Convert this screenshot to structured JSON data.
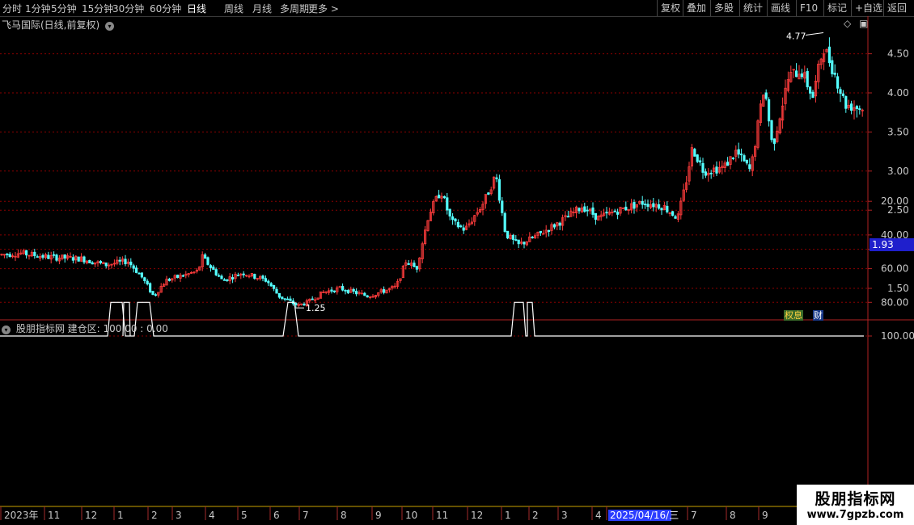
{
  "toolbar": {
    "left_items": [
      "分时",
      "1分钟",
      "5分钟",
      "15分钟",
      "30分钟",
      "60分钟",
      "日线",
      "周线",
      "月线",
      "多周期",
      "更多 >"
    ],
    "active": "日线",
    "right_items": [
      "复权",
      "叠加",
      "多股",
      "统计",
      "画线",
      "F10",
      "标记",
      "+自选",
      "返回"
    ]
  },
  "main_panel": {
    "title": "飞马国际(日线,前复权)",
    "max_label": "4.77",
    "min_label": "1.25",
    "current_price": "1.93",
    "y_ticks": [
      "4.50",
      "4.00",
      "3.50",
      "3.00",
      "2.50",
      "1.50"
    ],
    "badges": [
      "权息",
      "财"
    ]
  },
  "indicator_panel": {
    "title": "股朋指标网 建仓区: 100.00 : 0.00",
    "y_ticks": [
      "100.00",
      "80.00",
      "60.00",
      "40.00",
      "20.00"
    ]
  },
  "x_axis": {
    "labels": [
      "2023年",
      "11",
      "12",
      "1",
      "2",
      "3",
      "4",
      "5",
      "6",
      "7",
      "8",
      "9",
      "10",
      "11",
      "12",
      "1",
      "2",
      "3",
      "4",
      "2025/04/16/三",
      "7",
      "8",
      "9"
    ]
  },
  "watermark": {
    "line1": "股朋指标网",
    "line2": "www.7gpzb.com"
  },
  "colors": {
    "up": "#ff3c3c",
    "down": "#54ffff",
    "grid": "#8b0000",
    "axis": "#b22222",
    "line": "#ffffff"
  },
  "chart_data": {
    "type": "candlestick",
    "price_range": [
      1.1,
      4.9
    ],
    "key_points": [
      {
        "label": "start",
        "price": 1.95
      },
      {
        "label": "low",
        "price": 1.25
      },
      {
        "label": "mid-peak",
        "price": 3.0
      },
      {
        "label": "dip",
        "price": 2.0
      },
      {
        "label": "peak",
        "price": 4.77
      },
      {
        "label": "end",
        "price": 3.8
      }
    ],
    "indicator": {
      "range": [
        0,
        100
      ],
      "baseline": 100,
      "dips_to": 80
    }
  }
}
